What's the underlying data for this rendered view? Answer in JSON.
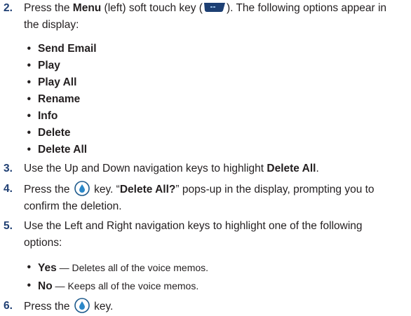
{
  "step2": {
    "number": "2.",
    "t1": "Press the ",
    "menu": "Menu",
    "t2": " (left) soft touch key (",
    "menu_key_icon": "menu-soft-key-icon",
    "t3": "). The following options appear in",
    "line2": "the display:"
  },
  "menu_options": [
    "Send Email",
    "Play",
    "Play All",
    "Rename",
    "Info",
    "Delete",
    "Delete All"
  ],
  "bullet": "•",
  "step3": {
    "number": "3.",
    "t1": "Use the Up and Down navigation keys to highlight ",
    "bold": "Delete All",
    "t2": "."
  },
  "step4": {
    "number": "4.",
    "t1": "Press the ",
    "ok_key_icon": "ok-key-icon",
    "t2": " key. “",
    "bold": "Delete All?",
    "t3": "” pops-up in the display, prompting you to",
    "line2": "confirm the deletion."
  },
  "step5": {
    "number": "5.",
    "line1": "Use the Left and Right navigation keys to highlight one of the following",
    "line2": "options:"
  },
  "options": [
    {
      "label": "Yes",
      "desc": " — Deletes all of the voice memos."
    },
    {
      "label": "No",
      "desc": " — Keeps all of the voice memos."
    }
  ],
  "step6": {
    "number": "6.",
    "t1": "Press the ",
    "ok_key_icon": "ok-key-icon",
    "t2": " key."
  },
  "colors": {
    "step_number": "#1f3f73",
    "key_icon": "#1d3f73",
    "ok_ring": "#1d5a8c",
    "ok_drop": "#2b88c9"
  }
}
